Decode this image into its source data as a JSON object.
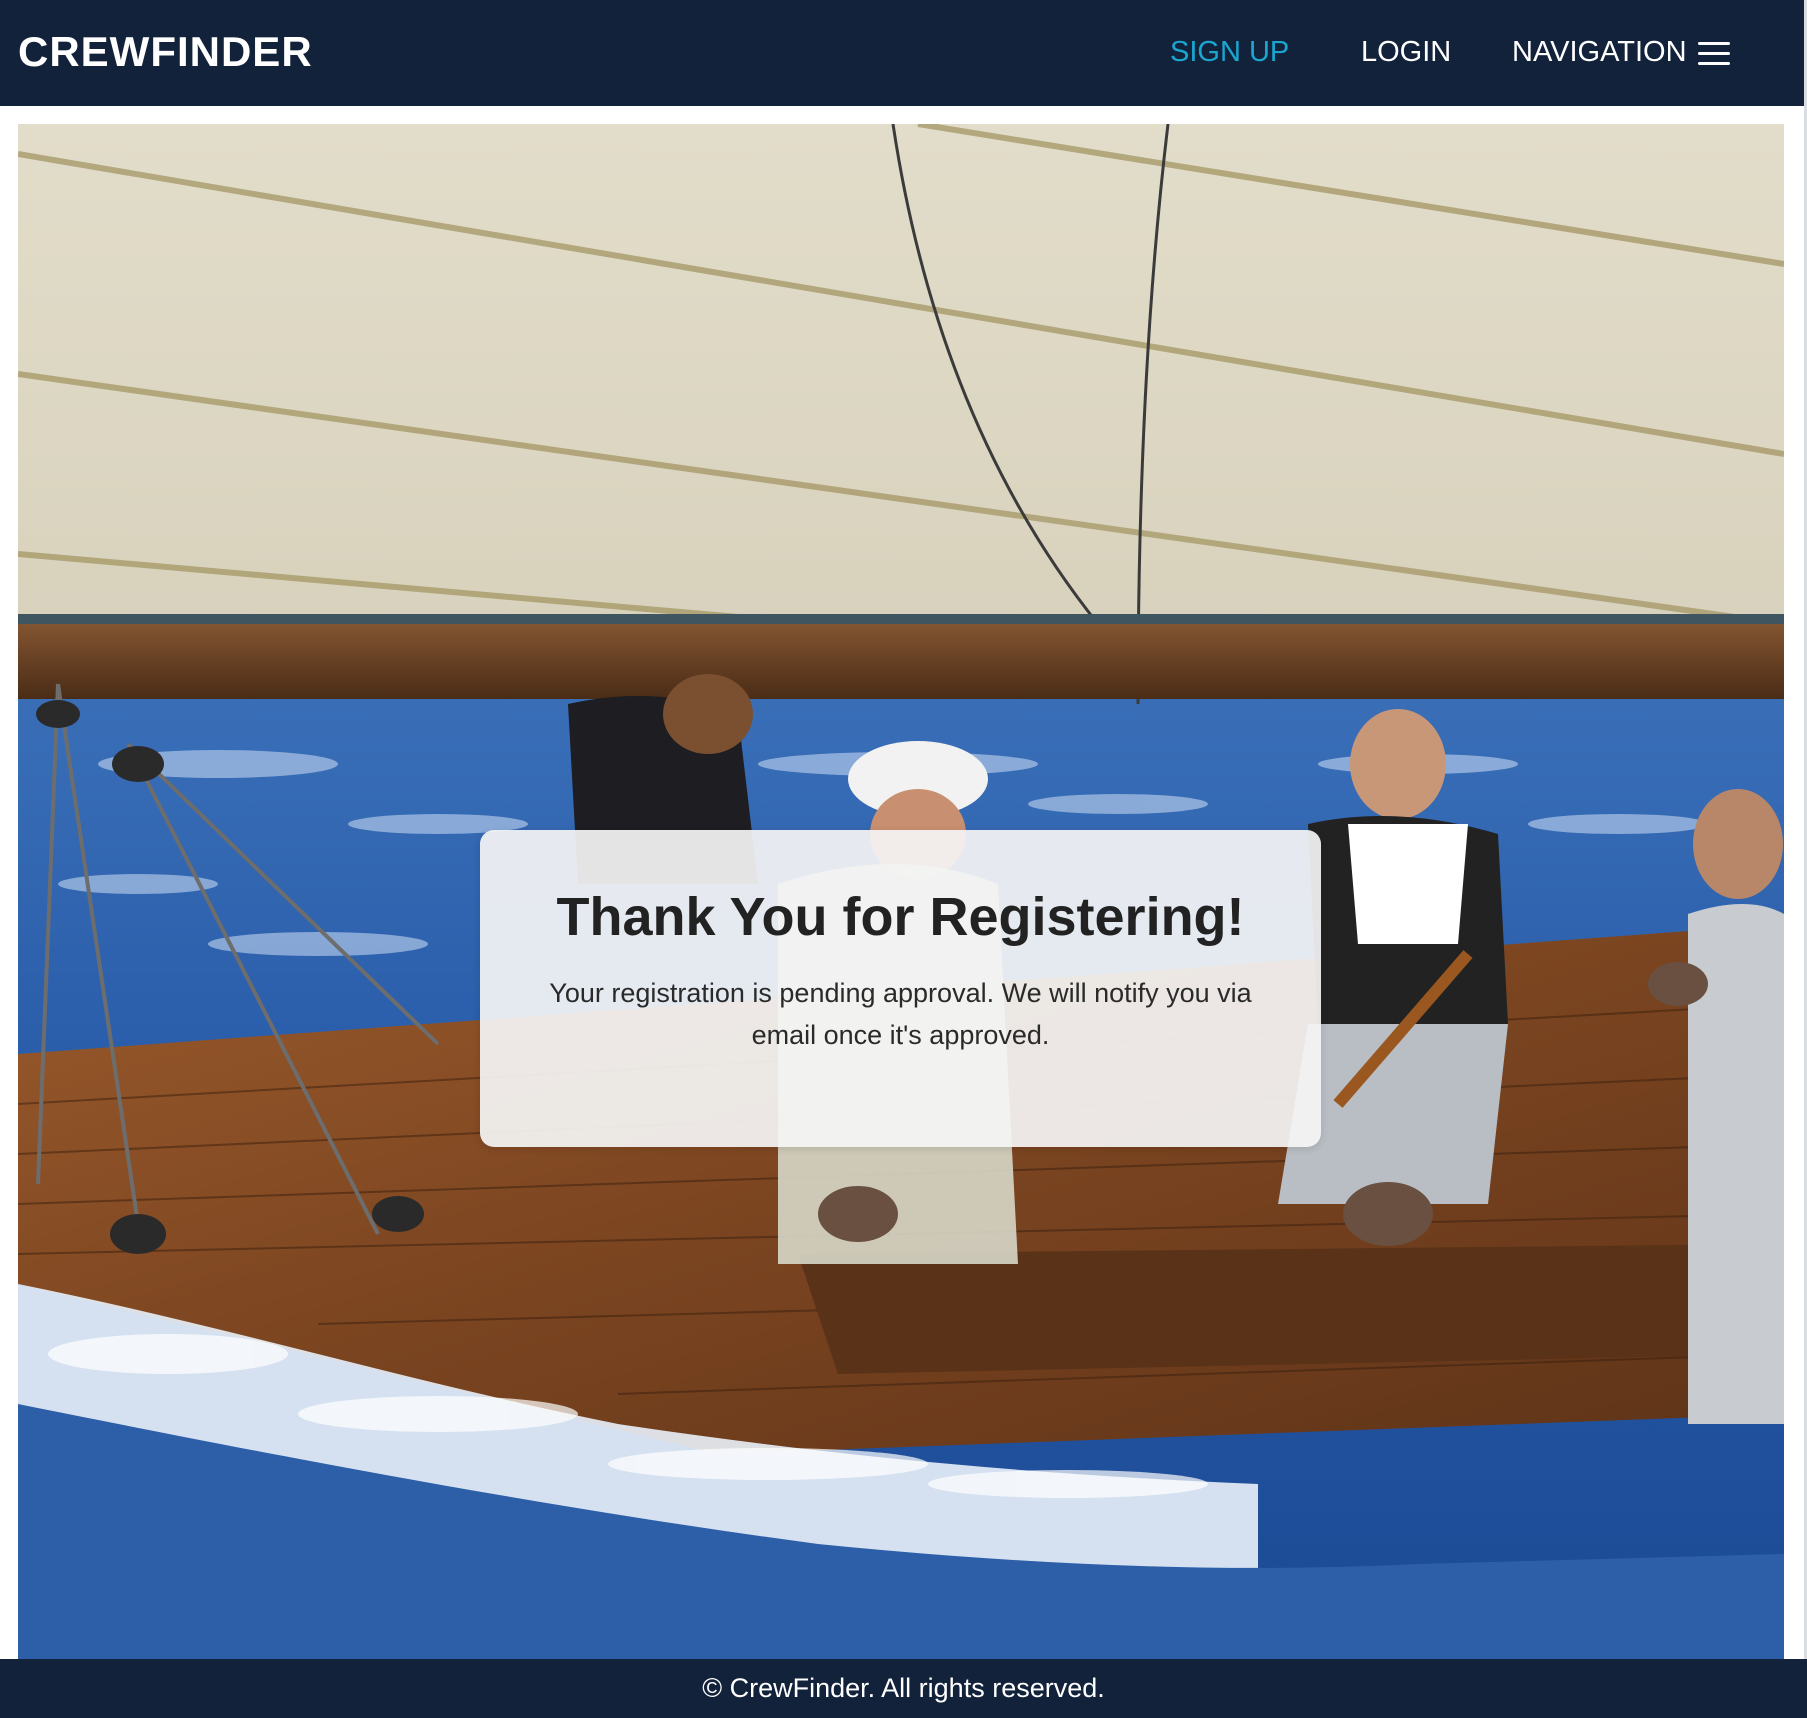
{
  "header": {
    "brand": "CREWFINDER",
    "nav": {
      "signup_label": "SIGN UP",
      "login_label": "LOGIN",
      "navigation_label": "NAVIGATION",
      "menu_icon": "hamburger-icon"
    }
  },
  "hero": {
    "image_subject": "sailing-crew-on-wooden-yacht"
  },
  "card": {
    "title": "Thank You for Registering!",
    "message": "Your registration is pending approval. We will notify you via email once it's approved."
  },
  "footer": {
    "text": "© CrewFinder. All rights reserved."
  },
  "colors": {
    "navbar_bg": "#12223b",
    "accent_link": "#1aa6cf",
    "card_bg": "#f5f5f5"
  }
}
